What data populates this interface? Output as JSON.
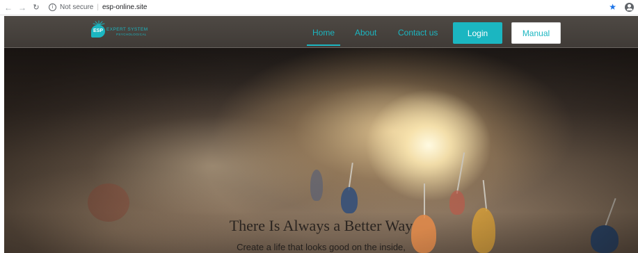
{
  "browser": {
    "security_text": "Not secure",
    "url": "esp-online.site"
  },
  "logo": {
    "badge": "ESP",
    "line1": "EXPERT SYSTEM",
    "line2": "PSYCHOLOGICAL"
  },
  "nav": {
    "home": "Home",
    "about": "About",
    "contact": "Contact us",
    "login": "Login",
    "manual": "Manual"
  },
  "hero": {
    "title": "There Is Always a Better Way",
    "subtitle": "Create a life that looks good on the inside,"
  },
  "colors": {
    "accent": "#1bb6c1"
  }
}
